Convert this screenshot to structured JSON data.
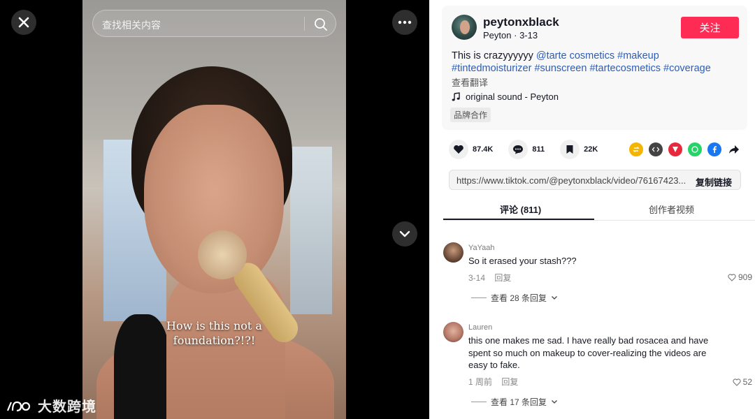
{
  "search": {
    "placeholder": "查找相关内容"
  },
  "video": {
    "caption_line1": "How is this not a",
    "caption_line2": "foundation?!?!"
  },
  "watermark": {
    "text": "大数跨境"
  },
  "author": {
    "username": "peytonxblack",
    "display_name": "Peyton",
    "date": "3-13",
    "follow_label": "关注"
  },
  "post": {
    "text": "This is crazyyyyyy",
    "hashtags": [
      "@tarte cosmetics",
      "#makeup",
      "#tintedmoisturizer",
      "#sunscreen",
      "#tartecosmetics",
      "#coverage"
    ],
    "translate_label": "查看翻译",
    "music": "original sound - Peyton",
    "brand_tag": "品牌合作"
  },
  "stats": {
    "likes": "87.4K",
    "comments": "811",
    "saves": "22K"
  },
  "share_icons": [
    "repost-icon",
    "embed-icon",
    "send-icon",
    "whatsapp-icon",
    "facebook-icon",
    "share-arrow-icon"
  ],
  "colors": {
    "accent": "#fe2c55",
    "hashtag": "#2b5db9"
  },
  "link": {
    "url": "https://www.tiktok.com/@peytonxblack/video/76167423...",
    "copy_label": "复制链接"
  },
  "tabs": {
    "comments": "评论 (811)",
    "creator_videos": "创作者视频"
  },
  "comments": [
    {
      "name": "YaYaah",
      "text": "So it erased your stash???",
      "date": "3-14",
      "reply_label": "回复",
      "likes": "909",
      "view_replies": "查看 28 条回复"
    },
    {
      "name": "Lauren",
      "text": "this one makes me sad. I have really bad rosacea and have spent so much on makeup to cover-realizing the videos are easy to fake.",
      "date": "1 周前",
      "reply_label": "回复",
      "likes": "52",
      "view_replies": "查看 17 条回复"
    }
  ]
}
